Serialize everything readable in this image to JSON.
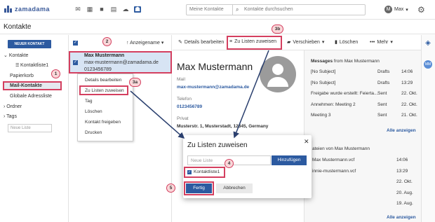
{
  "brand": {
    "name": "zamadama",
    "logo_color": "#3a5a9a"
  },
  "topbar": {
    "folder_select": "Meine Kontakte",
    "search_placeholder": "Kontakte durchsuchen",
    "user": "Max",
    "user_initial": "M"
  },
  "page_title": "Kontakte",
  "sidebar": {
    "new_contact": "NEUER KONTAKT",
    "items": [
      "Kontakte",
      "Kontaktliste1",
      "Papierkorb",
      "Mail-Kontakte",
      "Globale Adressliste",
      "Ordner",
      "Tags"
    ],
    "new_list_placeholder": "Neue Liste"
  },
  "list": {
    "sort_label": "Anzeigename",
    "contact": {
      "name": "Max Mustermann",
      "email": "max-mustermann@zamadama.de",
      "phone": "0123456789"
    }
  },
  "context_menu": [
    "Details bearbeiten",
    "Zu Listen zuweisen",
    "Tag",
    "Löschen",
    "Kontakt freigeben",
    "Drucken"
  ],
  "toolbar": {
    "edit": "Details bearbeiten",
    "assign": "Zu Listen zuweisen",
    "move": "Verschieben",
    "delete": "Löschen",
    "more": "Mehr"
  },
  "detail": {
    "name": "Max Mustermann",
    "mail_label": "Mail",
    "mail": "max-mustermann@zamadama.de",
    "phone_label": "Telefon",
    "phone": "0123456789",
    "private_label": "Privat",
    "address": "Musterstr. 1, Musterstadt, 12345, Germany"
  },
  "right_panel": {
    "messages_title": "Messages",
    "messages_from": "from Max Mustermann",
    "messages": [
      {
        "subject": "[No Subject]",
        "folder": "Drafts",
        "time": "14:06"
      },
      {
        "subject": "[No Subject]",
        "folder": "Drafts",
        "time": "13:29"
      },
      {
        "subject": "Freigabe wurde erstellt: Feierta...",
        "folder": "Sent",
        "time": "22. Okt."
      },
      {
        "subject": "Annehmen: Meeting 2",
        "folder": "Sent",
        "time": "22. Okt."
      },
      {
        "subject": "Meeting 3",
        "folder": "Sent",
        "time": "21. Okt."
      }
    ],
    "show_all": "Alle anzeigen",
    "files_title": "ateien von Max Mustermann",
    "files": [
      {
        "name": "Max Mustermann.vcf",
        "time": "14:06"
      },
      {
        "name": "innie-mustermann.vcf",
        "time": "13:29"
      },
      {
        "name": "",
        "time": "22. Okt."
      },
      {
        "name": "",
        "time": "20. Aug."
      },
      {
        "name": "",
        "time": "19. Aug."
      }
    ],
    "show_all_2": "Alle anzeigen"
  },
  "dialog": {
    "title": "Zu Listen zuweisen",
    "input_placeholder": "Neue Liste",
    "add": "Hinzufügen",
    "list_item": "Kontaktliste1",
    "done": "Fertig",
    "cancel": "Abbrechen"
  },
  "badges": {
    "b1": "1",
    "b2": "2",
    "b3a": "3a",
    "b3b": "3b",
    "b4": "4",
    "b5": "5"
  },
  "colors": {
    "accent": "#2c5aa0",
    "highlight": "#d43f5f",
    "selected_bg": "#d7e4f4"
  }
}
